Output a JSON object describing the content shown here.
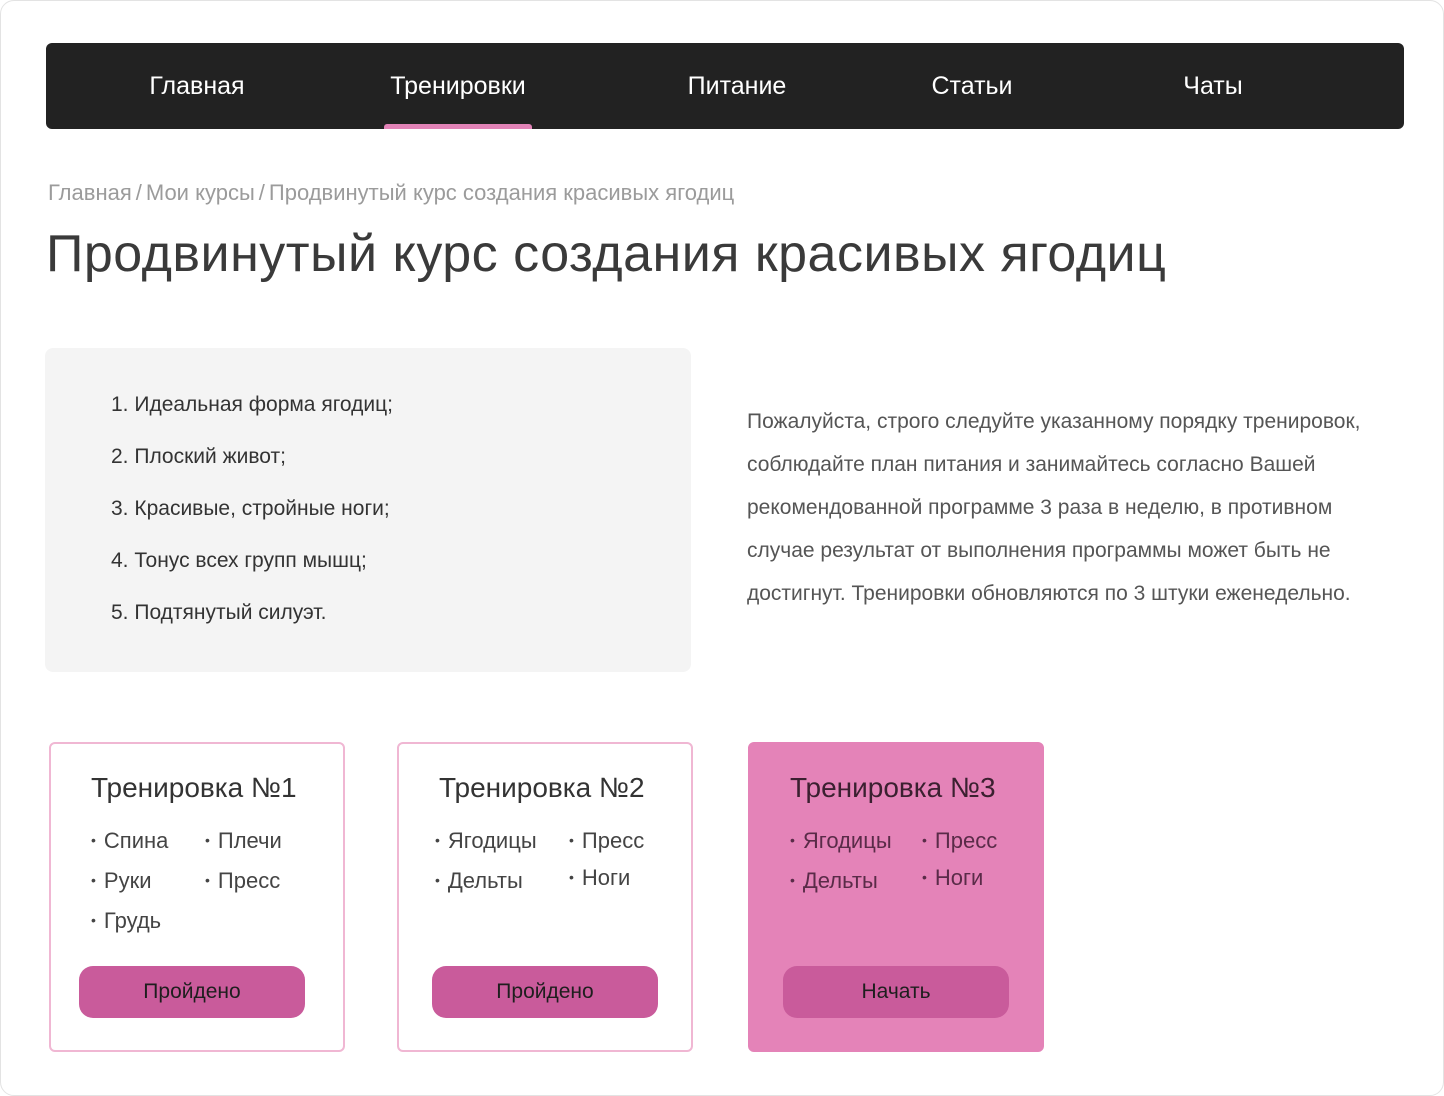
{
  "nav": {
    "items": [
      {
        "label": "Главная"
      },
      {
        "label": "Тренировки"
      },
      {
        "label": "Питание"
      },
      {
        "label": "Статьи"
      },
      {
        "label": "Чаты"
      }
    ],
    "active_index": 1,
    "accent_color": "#e283b7"
  },
  "breadcrumb": {
    "items": [
      "Главная",
      "Мои курсы",
      "Продвинутый курс создания красивых ягодиц"
    ],
    "separator": "/"
  },
  "page": {
    "title": "Продвинутый  курс создания красивых ягодиц"
  },
  "benefits": [
    "1. Идеальная форма ягодиц;",
    "2. Плоский живот;",
    "3. Красивые, стройные ноги;",
    "4. Тонус всех групп мышц;",
    "5. Подтянутый силуэт."
  ],
  "notice": "Пожалуйста, строго следуйте указанному порядку тренировок, соблюдайте план питания и занимайтесь согласно Вашей рекомендованной программе 3 раза в неделю, в противном случае результат от выполнения программы может быть не достигнут. Тренировки обновляются по 3 штуки еженедельно.",
  "workouts": [
    {
      "title": "Тренировка №1",
      "muscles": [
        "Спина",
        "Плечи",
        "Руки",
        "Пресс",
        "Грудь"
      ],
      "button_label": "Пройдено",
      "status": "completed"
    },
    {
      "title": "Тренировка №2",
      "muscles": [
        "Ягодицы",
        "Пресс",
        "Дельты",
        "Ноги"
      ],
      "button_label": "Пройдено",
      "status": "completed"
    },
    {
      "title": "Тренировка №3",
      "muscles": [
        "Ягодицы",
        "Пресс",
        "Дельты",
        "Ноги"
      ],
      "button_label": "Начать",
      "status": "current"
    }
  ]
}
